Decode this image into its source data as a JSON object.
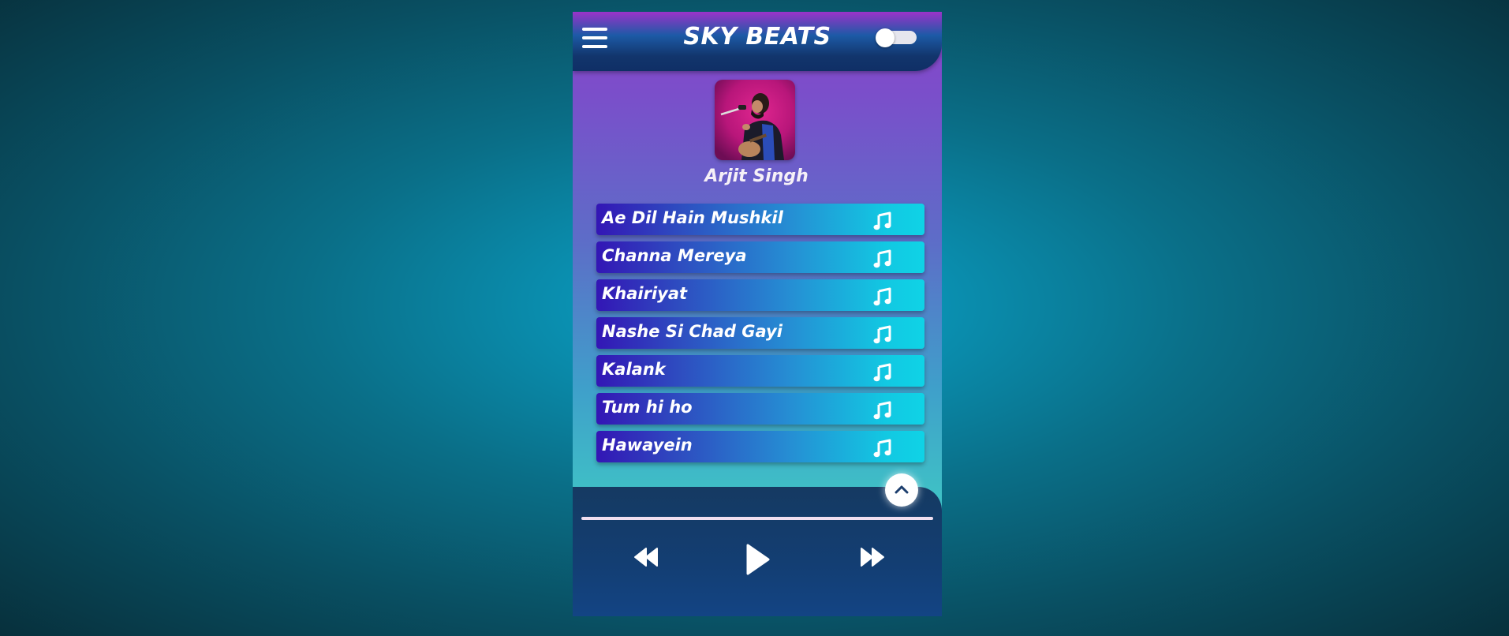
{
  "app": {
    "title": "SKY BEATS",
    "dark_mode_toggle": "off"
  },
  "artist": {
    "name": "Arjit Singh"
  },
  "songs": [
    {
      "title": "Ae Dil Hain Mushkil"
    },
    {
      "title": "Channa Mereya"
    },
    {
      "title": "Khairiyat"
    },
    {
      "title": "Nashe Si Chad Gayi"
    },
    {
      "title": "Kalank"
    },
    {
      "title": "Tum hi ho"
    },
    {
      "title": "Hawayein"
    }
  ],
  "icons": {
    "menu": "hamburger-menu-icon",
    "song": "music-note-icon",
    "scroll_top": "chevron-up-icon",
    "previous": "rewind-icon",
    "play": "play-icon",
    "next": "fast-forward-icon"
  },
  "player": {
    "progress_fraction": 0
  },
  "colors": {
    "header_top": "#9a33c9",
    "header_bottom": "#0f2f66",
    "song_item_start": "#3316b5",
    "song_item_end": "#0fd3e6",
    "player_bg": "#133e73",
    "accent_icon": "#1d3f6e"
  }
}
